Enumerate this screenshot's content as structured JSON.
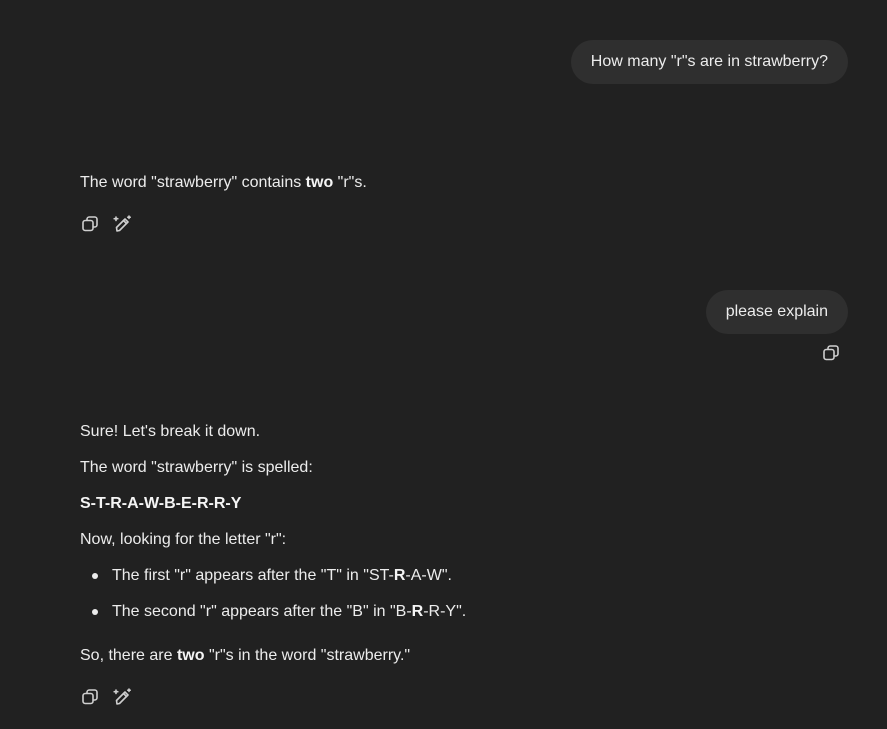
{
  "conversation": {
    "user_message_1": "How many \"r\"s are in strawberry?",
    "assistant_message_1": {
      "prefix": "The word \"strawberry\" contains ",
      "bold": "two",
      "suffix": " \"r\"s."
    },
    "user_message_2": "please explain",
    "assistant_message_2": {
      "intro": "Sure! Let's break it down.",
      "spelled_line": "The word \"strawberry\" is spelled:",
      "spelling": "S-T-R-A-W-B-E-R-R-Y",
      "looking_line": "Now, looking for the letter \"r\":",
      "bullet_1": {
        "pre": "The first \"r\" appears after the \"T\" in \"ST-",
        "bold": "R",
        "post": "-A-W\"."
      },
      "bullet_2": {
        "pre": "The second \"r\" appears after the \"B\" in \"B-",
        "bold": "R",
        "post": "-R-Y\"."
      },
      "conclusion": {
        "prefix": "So, there are ",
        "bold": "two",
        "suffix": " \"r\"s in the word \"strawberry.\""
      }
    }
  },
  "icons": {
    "copy": "copy-icon",
    "edit": "edit-sparkle-icon"
  },
  "colors": {
    "background": "#212121",
    "user_bubble": "#2f2f2f",
    "text": "#ececec"
  }
}
